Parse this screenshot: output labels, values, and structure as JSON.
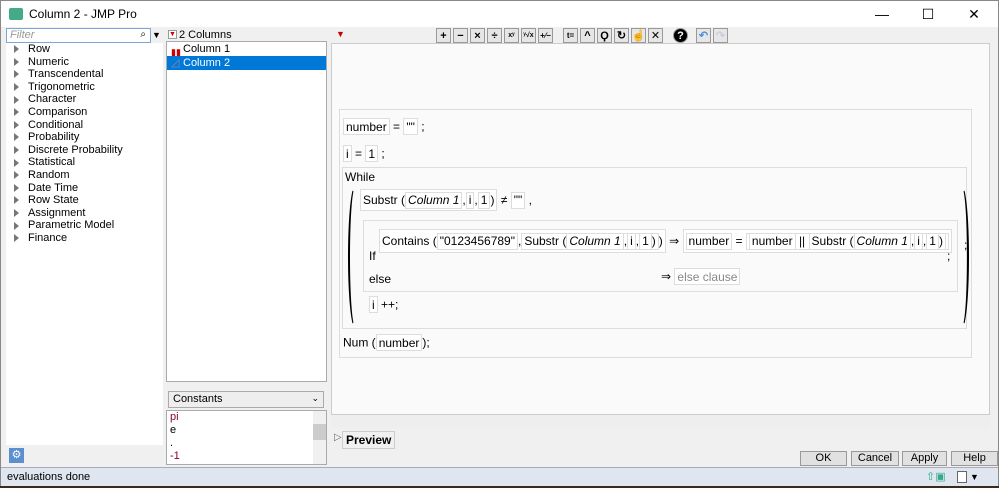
{
  "window": {
    "title": "Column 2 - JMP Pro",
    "minimize": "—",
    "maximize": "☐",
    "close": "✕"
  },
  "functions": {
    "filter_placeholder": "Filter",
    "items": [
      "Row",
      "Numeric",
      "Transcendental",
      "Trigonometric",
      "Character",
      "Comparison",
      "Conditional",
      "Probability",
      "Discrete Probability",
      "Statistical",
      "Random",
      "Date Time",
      "Row State",
      "Assignment",
      "Parametric Model",
      "Finance"
    ]
  },
  "columns": {
    "header": "2 Columns",
    "items": [
      "Column 1",
      "Column 2"
    ],
    "selected": "Column 2"
  },
  "constants": {
    "dropdown": "Constants",
    "items": [
      "pi",
      "e",
      ".",
      "-1"
    ]
  },
  "toolbar": {
    "buttons": [
      "plus",
      "minus",
      "multiply",
      "divide",
      "power",
      "root",
      "negate",
      "assign",
      "caret",
      "local",
      "swap",
      "peel",
      "delete",
      "help",
      "undo",
      "redo"
    ]
  },
  "formula": {
    "l1": {
      "var": "number",
      "op": "=",
      "val": "\"\"",
      "semi": ";"
    },
    "l2": {
      "var": "i",
      "op": "=",
      "val": "1",
      "semi": ";"
    },
    "while": "While",
    "cond": {
      "fn": "Substr",
      "arg1": "Column 1",
      "arg2": "i",
      "arg3": "1",
      "op": "≠",
      "val": "\"\"",
      "comma": ","
    },
    "if": {
      "kw": "If",
      "fn": "Contains",
      "str": "\"0123456789\"",
      "fn2": "Substr",
      "arg1": "Column 1",
      "arg2": "i",
      "arg3": "1",
      "arrow": "⇒",
      "target": "number",
      "eq": "=",
      "lhs": "number",
      "concat": "||",
      "fn3": "Substr",
      "else": "else",
      "else_clause": "else clause",
      "semi": ";"
    },
    "inc": {
      "var": "i",
      "op": "++",
      "semi": ";"
    },
    "while_semi": ";",
    "num": {
      "fn": "Num",
      "arg": "number",
      "semi": ";"
    }
  },
  "preview": "Preview",
  "buttons": {
    "ok": "OK",
    "cancel": "Cancel",
    "apply": "Apply",
    "help": "Help"
  },
  "status": "evaluations done"
}
